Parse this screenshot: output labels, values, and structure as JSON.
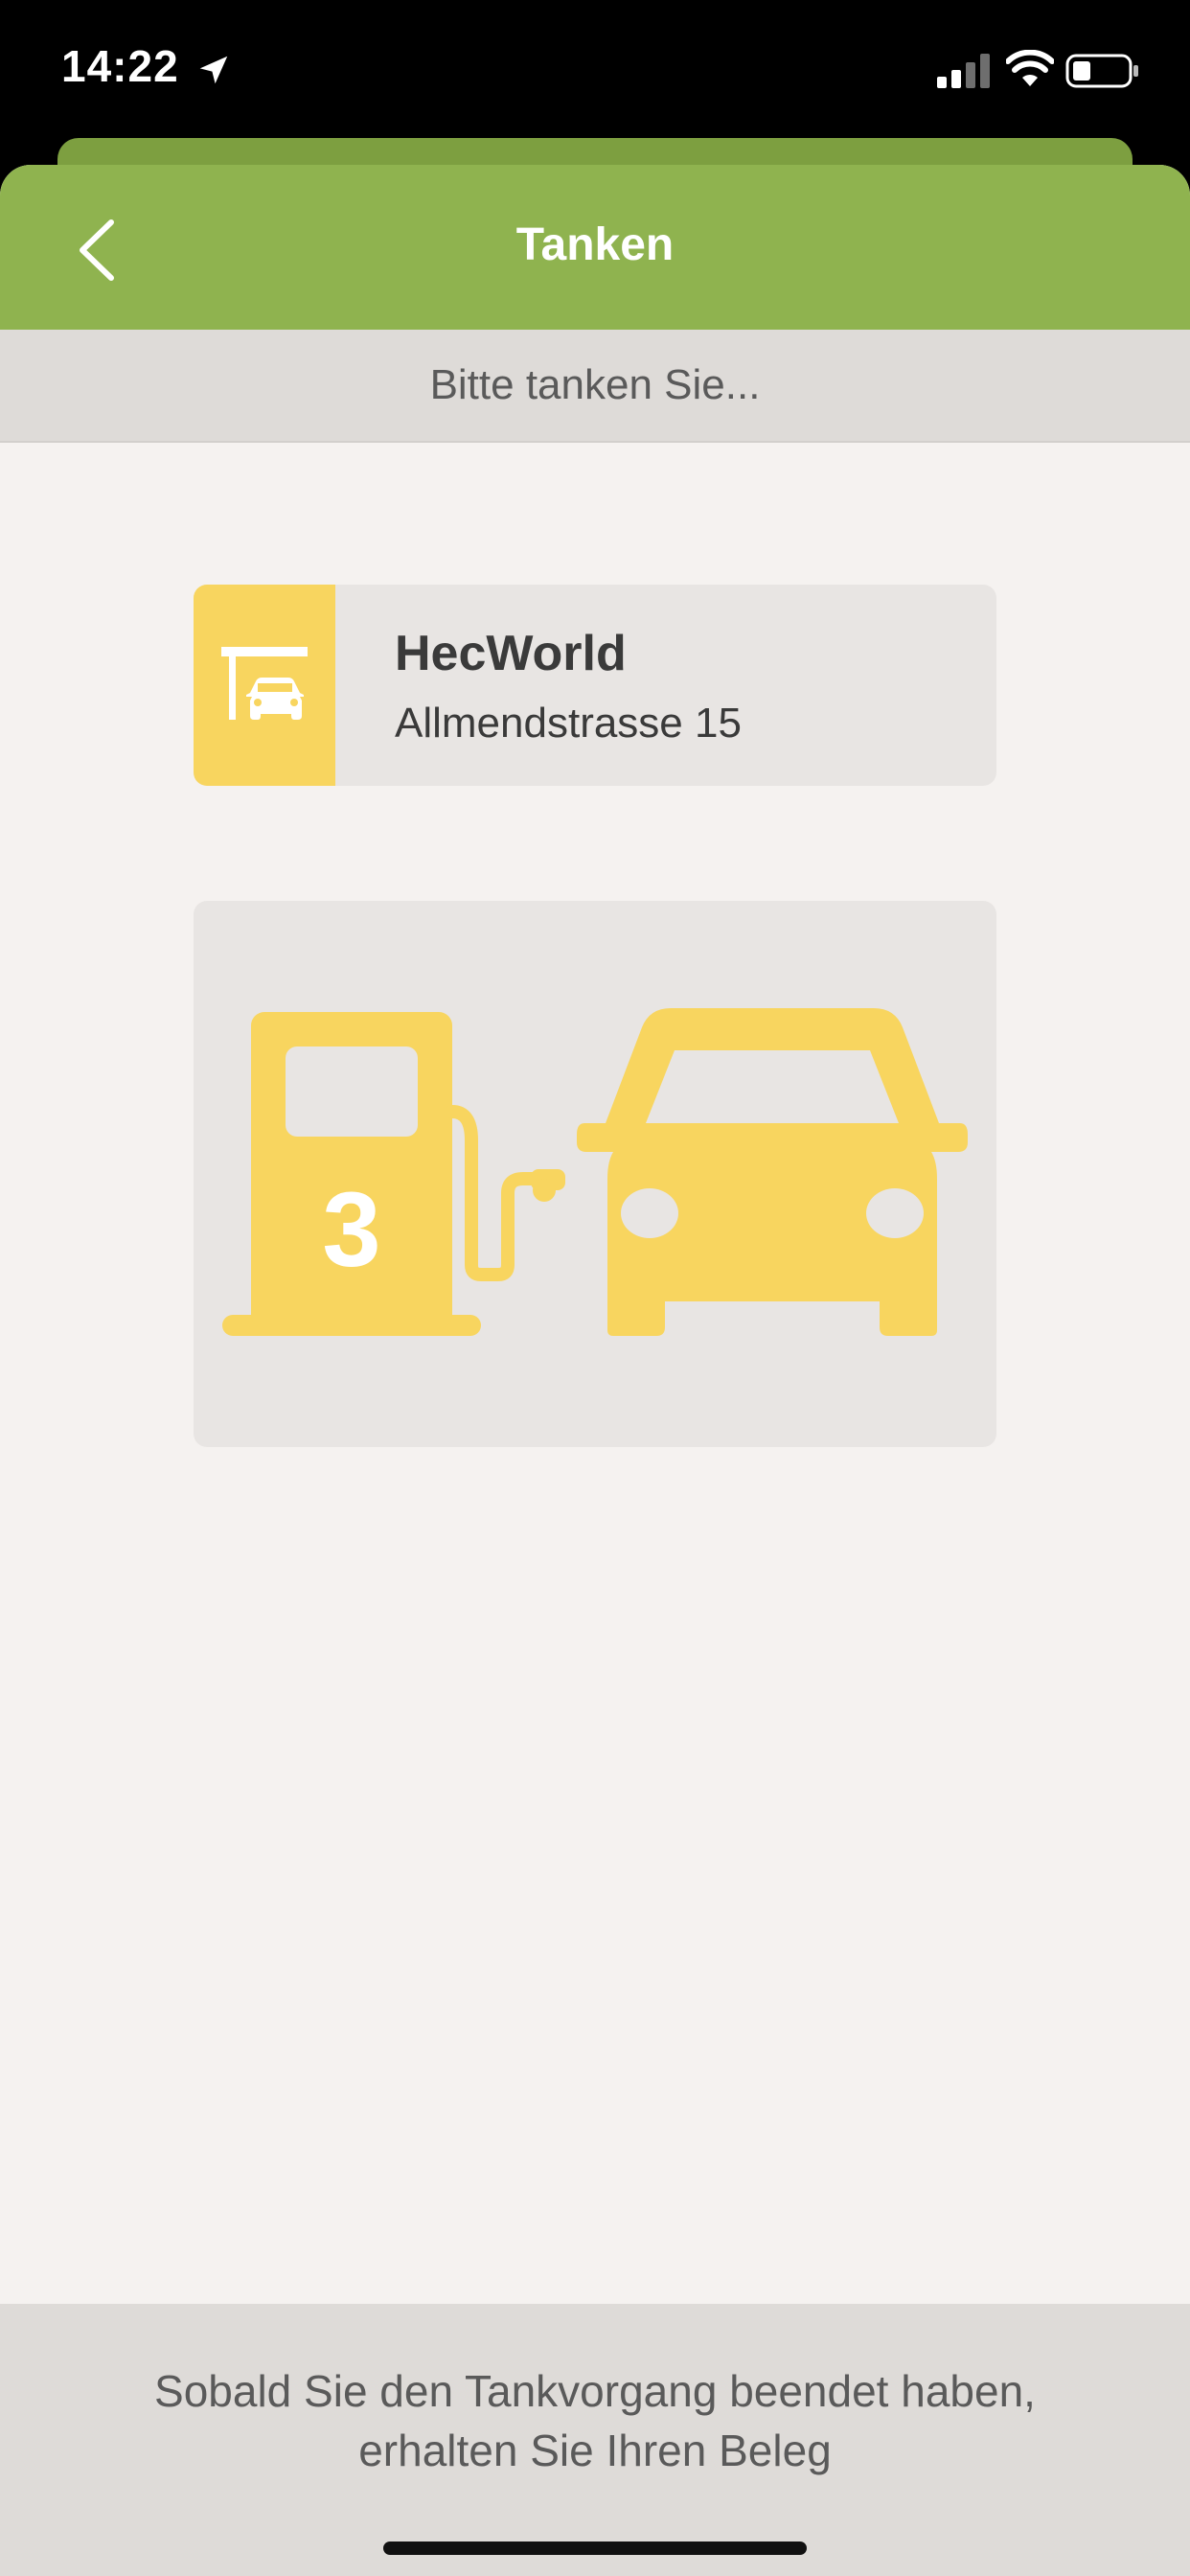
{
  "status_bar": {
    "time": "14:22"
  },
  "nav": {
    "title": "Tanken"
  },
  "sub_header": {
    "text": "Bitte tanken Sie..."
  },
  "station": {
    "name": "HecWorld",
    "address": "Allmendstrasse 15"
  },
  "pump": {
    "number": "3"
  },
  "footer": {
    "line1": "Sobald Sie den Tankvorgang beendet haben,",
    "line2": "erhalten Sie Ihren Beleg"
  },
  "colors": {
    "nav_green": "#8fb34f",
    "accent_yellow": "#f8d55f",
    "background": "#f5f2f0",
    "card_grey": "#e8e5e3"
  },
  "icons": [
    "back-chevron-icon",
    "location-arrow-icon",
    "signal-icon",
    "wifi-icon",
    "battery-icon",
    "gas-station-icon",
    "fuel-pump-icon",
    "car-icon"
  ]
}
